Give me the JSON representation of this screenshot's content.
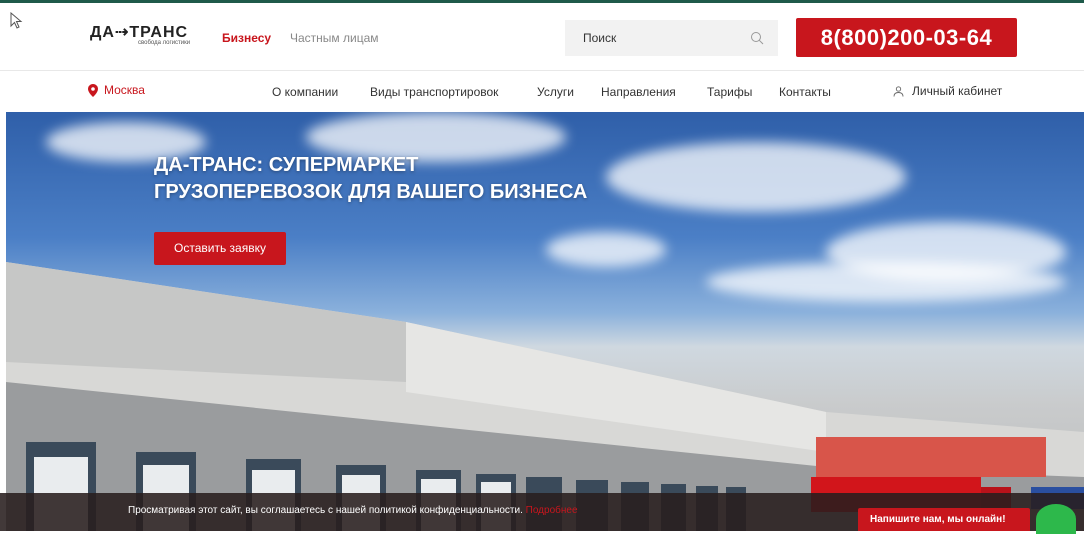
{
  "header": {
    "logo_text": "ДА⇢ТРАНС",
    "logo_tagline": "свобода логистики",
    "tabs": [
      {
        "label": "Бизнесу",
        "active": true
      },
      {
        "label": "Частным лицам",
        "active": false
      }
    ],
    "search_placeholder": "Поиск",
    "phone": "8(800)200-03-64"
  },
  "nav": {
    "city": "Москва",
    "items": [
      "О компании",
      "Виды транспортировок",
      "Услуги",
      "Направления",
      "Тарифы",
      "Контакты"
    ],
    "cabinet": "Личный кабинет"
  },
  "hero": {
    "title_line1": "ДА-ТРАНС: СУПЕРМАРКЕТ",
    "title_line2": "ГРУЗОПЕРЕВОЗОК ДЛЯ ВАШЕГО БИЗНЕСА",
    "button": "Оставить заявку"
  },
  "cookie": {
    "text": "Просматривая этот сайт, вы соглашаетесь с нашей политикой конфиденциальности. ",
    "link": "Подробнее"
  },
  "chat": {
    "label": "Напишите нам, мы онлайн!"
  },
  "colors": {
    "brand_red": "#c8161d",
    "online_green": "#2db84b"
  },
  "icons": [
    "cursor-icon",
    "search-icon",
    "location-pin-icon",
    "user-icon"
  ]
}
